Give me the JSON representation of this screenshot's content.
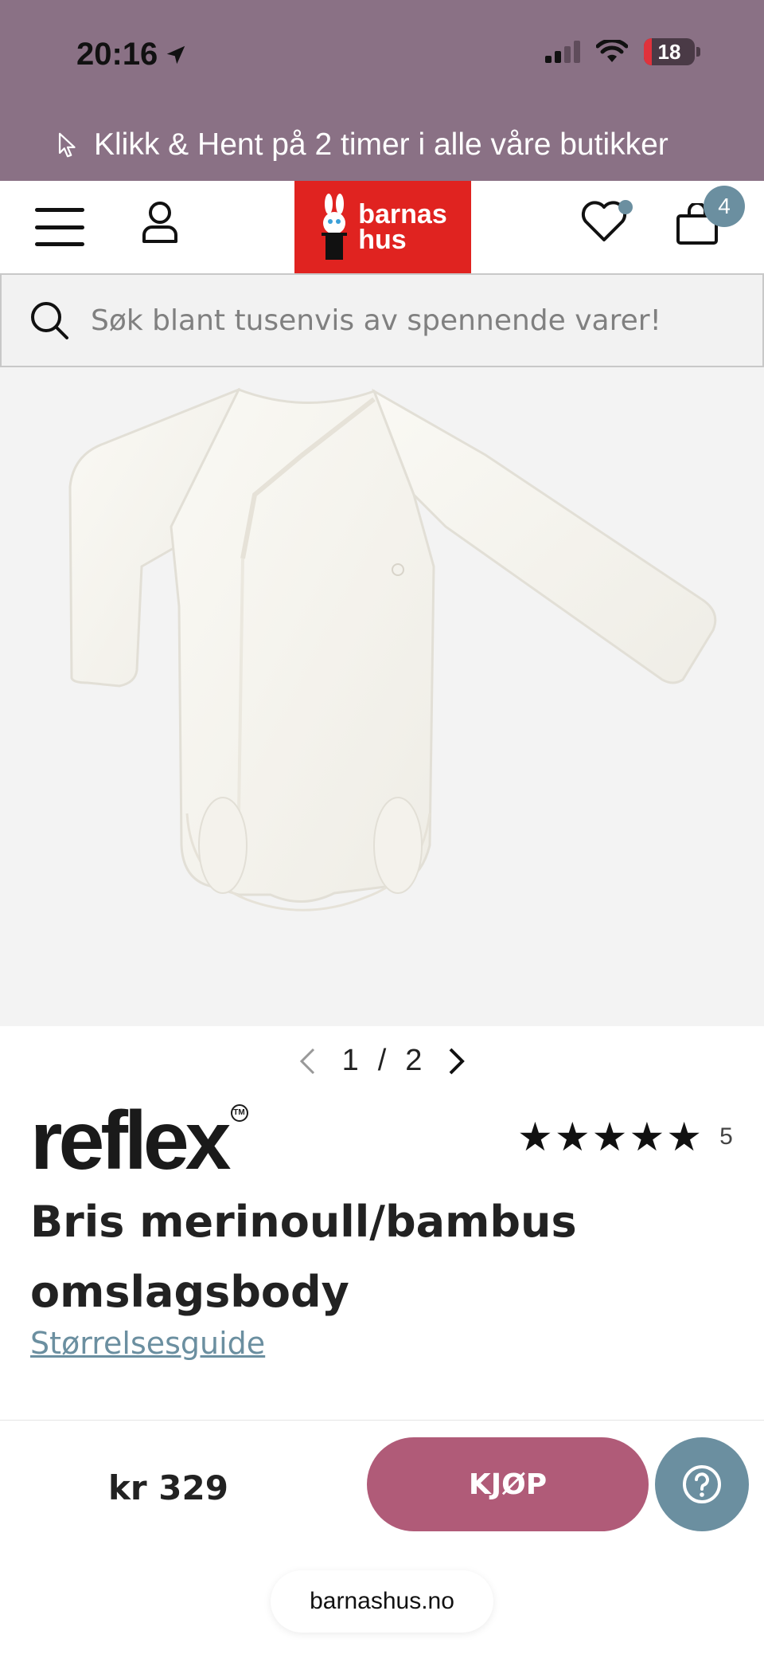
{
  "status_bar": {
    "time": "20:16",
    "battery": "18"
  },
  "promo": {
    "text": "Klikk & Hent på 2 timer i alle våre butikker"
  },
  "header": {
    "logo_line1": "barnas",
    "logo_line2": "hus",
    "cart_count": "4",
    "colors": {
      "logo_bg": "#e02320",
      "accent": "#6b8fa0",
      "top_bar": "#8a7185"
    }
  },
  "search": {
    "placeholder": "Søk blant tusenvis av spennende varer!"
  },
  "gallery": {
    "current": "1",
    "separator": "/",
    "total": "2"
  },
  "product": {
    "brand": "reflex",
    "rating_stars": "★★★★★",
    "rating_count": "5",
    "title": "Bris merinoull/bambus omslagsbody",
    "size_guide": "Størrelsesguide"
  },
  "bottom_bar": {
    "price": "kr 329",
    "buy_label": "KJØP",
    "buy_color": "#b05b78",
    "url": "barnashus.no"
  }
}
